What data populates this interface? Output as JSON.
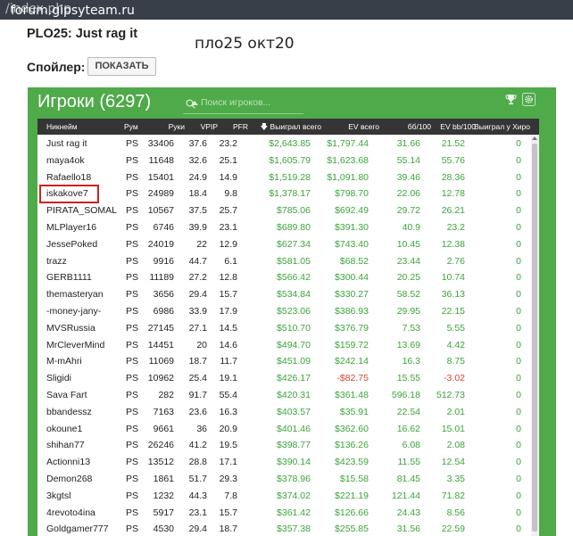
{
  "browser": {
    "url_domain": "forum.gipsyteam.ru",
    "url_path": "/index.php"
  },
  "post": {
    "title": "PLO25: Just rag it",
    "handwritten_note": "пло25 окт20",
    "spoiler_label": "Спойлер:",
    "spoiler_button": "ПОКАЗАТЬ"
  },
  "panel": {
    "title": "Игроки (6297)",
    "search_placeholder": "Поиск игроков...",
    "accent_color": "#4faa4a",
    "header_color": "#353535",
    "positive_color": "#3aa53a",
    "negative_color": "#d9452b"
  },
  "columns": {
    "name": "Никнейм",
    "room": "Рум",
    "hands": "Руки",
    "vpip": "VPIP",
    "pfr": "PFR",
    "won": "Выиграл всего",
    "ev": "EV всего",
    "bb100": "бб/100",
    "evbb100": "EV bb/100",
    "hero": "Выиграл у Хиро"
  },
  "rows": [
    {
      "name": "Just rag it",
      "room": "PS",
      "hands": "33406",
      "vpip": "37.6",
      "pfr": "23.2",
      "won": "$2,643.85",
      "ev": "$1,797.44",
      "bb": "31.66",
      "evbb": "21.52",
      "hero": "0"
    },
    {
      "name": "maya4ok",
      "room": "PS",
      "hands": "11648",
      "vpip": "32.6",
      "pfr": "25.1",
      "won": "$1,605.79",
      "ev": "$1,623.68",
      "bb": "55.14",
      "evbb": "55.76",
      "hero": "0"
    },
    {
      "name": "Rafaello18",
      "room": "PS",
      "hands": "15401",
      "vpip": "24.9",
      "pfr": "14.9",
      "won": "$1,519.28",
      "ev": "$1,091.80",
      "bb": "39.46",
      "evbb": "28.36",
      "hero": "0"
    },
    {
      "name": "iskakove7",
      "room": "PS",
      "hands": "24989",
      "vpip": "18.4",
      "pfr": "9.8",
      "won": "$1,378.17",
      "ev": "$798.70",
      "bb": "22.06",
      "evbb": "12.78",
      "hero": "0"
    },
    {
      "name": "PIRATA_SOMAL",
      "room": "PS",
      "hands": "10567",
      "vpip": "37.5",
      "pfr": "25.7",
      "won": "$785.06",
      "ev": "$692.49",
      "bb": "29.72",
      "evbb": "26.21",
      "hero": "0"
    },
    {
      "name": "MLPlayer16",
      "room": "PS",
      "hands": "6746",
      "vpip": "39.9",
      "pfr": "23.1",
      "won": "$689.80",
      "ev": "$391.30",
      "bb": "40.9",
      "evbb": "23.2",
      "hero": "0"
    },
    {
      "name": "JessePoked",
      "room": "PS",
      "hands": "24019",
      "vpip": "22",
      "pfr": "12.9",
      "won": "$627.34",
      "ev": "$743.40",
      "bb": "10.45",
      "evbb": "12.38",
      "hero": "0"
    },
    {
      "name": "trazz",
      "room": "PS",
      "hands": "9916",
      "vpip": "44.7",
      "pfr": "6.1",
      "won": "$581.05",
      "ev": "$68.52",
      "bb": "23.44",
      "evbb": "2.76",
      "hero": "0"
    },
    {
      "name": "GERB1111",
      "room": "PS",
      "hands": "11189",
      "vpip": "27.2",
      "pfr": "12.8",
      "won": "$566.42",
      "ev": "$300.44",
      "bb": "20.25",
      "evbb": "10.74",
      "hero": "0"
    },
    {
      "name": "themasteryan",
      "room": "PS",
      "hands": "3656",
      "vpip": "29.4",
      "pfr": "15.7",
      "won": "$534.84",
      "ev": "$330.27",
      "bb": "58.52",
      "evbb": "36.13",
      "hero": "0"
    },
    {
      "name": "-money-jany-",
      "room": "PS",
      "hands": "6986",
      "vpip": "33.9",
      "pfr": "17.9",
      "won": "$523.06",
      "ev": "$386.93",
      "bb": "29.95",
      "evbb": "22.15",
      "hero": "0"
    },
    {
      "name": "MVSRussia",
      "room": "PS",
      "hands": "27145",
      "vpip": "27.1",
      "pfr": "14.5",
      "won": "$510.70",
      "ev": "$376.79",
      "bb": "7.53",
      "evbb": "5.55",
      "hero": "0"
    },
    {
      "name": "MrCleverMind",
      "room": "PS",
      "hands": "14451",
      "vpip": "20",
      "pfr": "14.6",
      "won": "$494.70",
      "ev": "$159.72",
      "bb": "13.69",
      "evbb": "4.42",
      "hero": "0"
    },
    {
      "name": "M-mAhri",
      "room": "PS",
      "hands": "11069",
      "vpip": "18.7",
      "pfr": "11.7",
      "won": "$451.09",
      "ev": "$242.14",
      "bb": "16.3",
      "evbb": "8.75",
      "hero": "0"
    },
    {
      "name": "Sligidi",
      "room": "PS",
      "hands": "10962",
      "vpip": "25.4",
      "pfr": "19.1",
      "won": "$426.17",
      "ev": "-$82.75",
      "bb": "15.55",
      "evbb": "-3.02",
      "hero": "0",
      "neg": true
    },
    {
      "name": "Sava Fart",
      "room": "PS",
      "hands": "282",
      "vpip": "91.7",
      "pfr": "55.4",
      "won": "$420.31",
      "ev": "$361.48",
      "bb": "596.18",
      "evbb": "512.73",
      "hero": "0"
    },
    {
      "name": "bbandessz",
      "room": "PS",
      "hands": "7163",
      "vpip": "23.6",
      "pfr": "16.3",
      "won": "$403.57",
      "ev": "$35.91",
      "bb": "22.54",
      "evbb": "2.01",
      "hero": "0"
    },
    {
      "name": "okoune1",
      "room": "PS",
      "hands": "9661",
      "vpip": "36",
      "pfr": "20.9",
      "won": "$401.46",
      "ev": "$362.60",
      "bb": "16.62",
      "evbb": "15.01",
      "hero": "0"
    },
    {
      "name": "shihan77",
      "room": "PS",
      "hands": "26246",
      "vpip": "41.2",
      "pfr": "19.5",
      "won": "$398.77",
      "ev": "$136.26",
      "bb": "6.08",
      "evbb": "2.08",
      "hero": "0"
    },
    {
      "name": "Actionni13",
      "room": "PS",
      "hands": "13512",
      "vpip": "28.8",
      "pfr": "17.1",
      "won": "$390.14",
      "ev": "$423.59",
      "bb": "11.55",
      "evbb": "12.54",
      "hero": "0"
    },
    {
      "name": "Demon268",
      "room": "PS",
      "hands": "1861",
      "vpip": "51.7",
      "pfr": "29.3",
      "won": "$378.96",
      "ev": "$15.58",
      "bb": "81.45",
      "evbb": "3.35",
      "hero": "0"
    },
    {
      "name": "3kgtsl",
      "room": "PS",
      "hands": "1232",
      "vpip": "44.3",
      "pfr": "7.8",
      "won": "$374.02",
      "ev": "$221.19",
      "bb": "121.44",
      "evbb": "71.82",
      "hero": "0"
    },
    {
      "name": "4revoto4ina",
      "room": "PS",
      "hands": "5917",
      "vpip": "23.1",
      "pfr": "15.7",
      "won": "$361.42",
      "ev": "$126.66",
      "bb": "24.43",
      "evbb": "8.56",
      "hero": "0"
    },
    {
      "name": "Goldgamer777",
      "room": "PS",
      "hands": "4530",
      "vpip": "29.4",
      "pfr": "18.7",
      "won": "$357.38",
      "ev": "$255.85",
      "bb": "31.56",
      "evbb": "22.59",
      "hero": "0"
    }
  ]
}
